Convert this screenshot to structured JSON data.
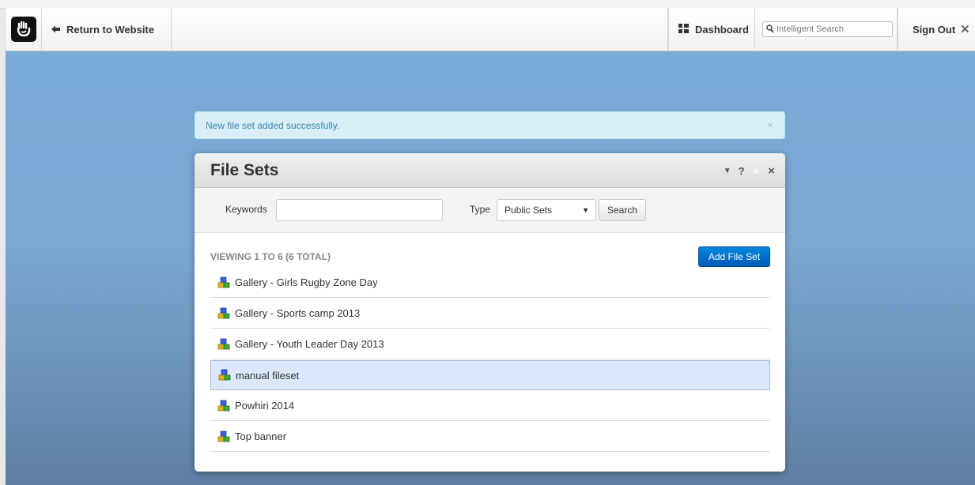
{
  "topbar": {
    "return_label": "Return to Website",
    "dashboard_label": "Dashboard",
    "search_placeholder": "Intelligent Search",
    "signout_label": "Sign Out"
  },
  "alert": {
    "message": "New file set added successfully.",
    "close_glyph": "×"
  },
  "panel": {
    "title": "File Sets",
    "tools": {
      "collapse": "▼",
      "help": "?",
      "favorite": "★",
      "close": "×"
    },
    "filter": {
      "keywords_label": "Keywords",
      "keywords_value": "",
      "type_label": "Type",
      "type_selected": "Public Sets",
      "search_button": "Search"
    },
    "viewing_text": "VIEWING 1 TO 6 (6 TOTAL)",
    "add_button": "Add File Set",
    "items": [
      {
        "label": "Gallery - Girls Rugby Zone Day",
        "selected": false
      },
      {
        "label": "Gallery - Sports camp 2013",
        "selected": false
      },
      {
        "label": "Gallery - Youth Leader Day 2013",
        "selected": false
      },
      {
        "label": "manual fileset",
        "selected": true
      },
      {
        "label": "Powhiri 2014",
        "selected": false
      },
      {
        "label": "Top banner",
        "selected": false
      }
    ]
  },
  "colors": {
    "accent": "#0070cc",
    "alert_bg": "#d9edf7",
    "alert_text": "#3a87ad",
    "selected_row": "#dce7fb"
  }
}
